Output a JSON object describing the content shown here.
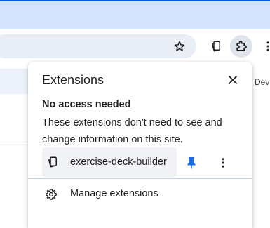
{
  "toolbar": {
    "bookmark_icon": "star-icon",
    "deck_extension_icon": "cards-icon",
    "extensions_icon": "puzzle-icon",
    "menu_icon": "more-vert-icon"
  },
  "page": {
    "right_text": "Dev"
  },
  "popup": {
    "title": "Extensions",
    "close_icon": "close-icon",
    "section_title": "No access needed",
    "section_description": "These extensions don't need to see and change information on this site.",
    "extensions": [
      {
        "name": "exercise-deck-builder",
        "icon": "cards-icon",
        "pinned": true
      }
    ],
    "manage_label": "Manage extensions",
    "manage_icon": "gear-icon"
  },
  "colors": {
    "accent": "#0b57d0",
    "pin": "#1a6ee6",
    "tab_strip": "#d3e3fd",
    "omnibox": "#e9eef6"
  }
}
